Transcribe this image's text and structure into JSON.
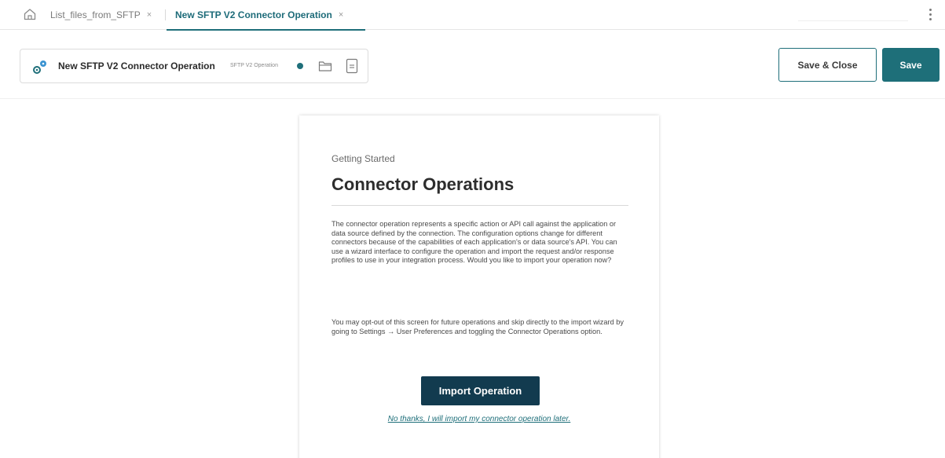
{
  "tabs": {
    "home_icon": "home-icon",
    "tab1_label": "List_files_from_SFTP",
    "tab2_label": "New SFTP V2 Connector Operation",
    "close_glyph": "×"
  },
  "header": {
    "icon": "connector-operation-icon",
    "title": "New SFTP V2 Connector Operation",
    "subtitle": "SFTP V2 Operation",
    "status_color": "#1f6f7a"
  },
  "actions": {
    "save_close_label": "Save & Close",
    "save_label": "Save"
  },
  "getting_started": {
    "eyebrow": "Getting Started",
    "title": "Connector Operations",
    "paragraph1": "The connector operation represents a specific action or API call against the application or data source defined by the connection. The configuration options change for different connectors because of the capabilities of each application's or data source's API. You can use a wizard interface to configure the operation and import the request and/or response profiles to use in your integration process. Would you like to import your operation now?",
    "paragraph2": "You may opt-out of this screen for future operations and skip directly to the import wizard by going to Settings → User Preferences and toggling the Connector Operations option.",
    "import_button": "Import Operation",
    "later_link": "No thanks, I will import my connector operation later."
  },
  "colors": {
    "accent": "#1f6f7a",
    "import_button_bg": "#123b4f"
  }
}
